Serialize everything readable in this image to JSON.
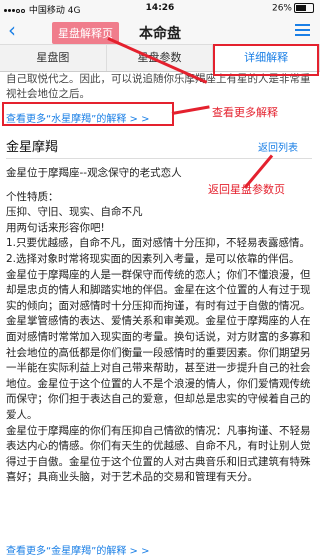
{
  "status": {
    "carrier": "中国移动",
    "network": "4G",
    "time": "14:26",
    "battery": "26%"
  },
  "nav": {
    "title": "本命盘",
    "back": "‹"
  },
  "tabs": [
    {
      "label": "星盘图"
    },
    {
      "label": "星盘参数"
    },
    {
      "label": "详细解释"
    }
  ],
  "annotations": {
    "page_label": "星盘解释页",
    "more_label": "查看更多解释",
    "return_label": "返回星盘参数页"
  },
  "content": {
    "cutoff_text": "自己取悦代之。因此，可以说追随你乐摩羯座上有星的人是非常重视社会地位之后。",
    "more_link_top": "查看更多“水星摩羯”的解释 > >",
    "section_title": "金星摩羯",
    "return_link": "返回列表",
    "lines": [
      "金星位于摩羯座--观念保守的老式恋人",
      "",
      "个性特质：",
      "压抑、守旧、现实、自命不凡",
      "用两句话来形容你吧!",
      "1.只要优越感，自命不凡，面对感情十分压抑，不轻易表露感情。",
      "2.选择对象时常将现实面的因素列入考量，是可以依靠的伴侣。",
      "金星位于摩羯座的人是一群保守而传统的恋人；你们不懂浪漫，但却是忠贞的情人和脚踏实地的伴侣。金星在这个位置的人有过于现实的倾向；面对感情时十分压抑而拘谨，有时有过于自傲的情况。",
      "金星掌管感情的表达、爱情关系和审美观。金星位于摩羯座的人在面对感情时常常加入现实面的考量。换句话说，对方财富的多寡和社会地位的高低都是你们衡量一段感情时的重要因素。你们期望另一半能在实际利益上对自己带来帮助，甚至进一步提升自己的社会地位。金星位于这个位置的人不是个浪漫的情人，你们爱情观传统而保守；你们担于表达自己的爱意，但却总是忠实的守候着自己的爱人。",
      "金星位于摩羯座的你们有压抑自己情欲的情况：凡事拘谨、不轻易表达内心的情感。你们有天生的优越感、自命不凡，有时让别人觉得过于自傲。金星位于这个位置的人对古典音乐和旧式建筑有特殊喜好；具商业头脑，对于艺术品的交易和管理有天分。"
    ],
    "more_link_bottom": "查看更多“金星摩羯”的解释 > >"
  }
}
